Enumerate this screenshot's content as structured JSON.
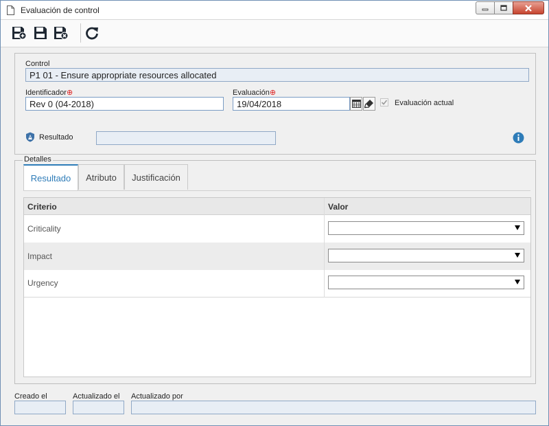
{
  "window": {
    "title": "Evaluación de control"
  },
  "toolbar": {
    "buttons": [
      {
        "icon": "save-and-new-icon"
      },
      {
        "icon": "save-icon"
      },
      {
        "icon": "save-and-close-icon"
      },
      {
        "icon": "refresh-icon"
      }
    ]
  },
  "form": {
    "control_label": "Control",
    "control_value": "P1 01 - Ensure appropriate resources allocated",
    "identifier_label": "Identificador",
    "identifier_value": "Rev 0 (04-2018)",
    "evaluation_label": "Evaluación",
    "evaluation_value": "19/04/2018",
    "current_eval_label": "Evaluación actual",
    "current_eval_checked": true,
    "result_label": "Resultado",
    "result_value": ""
  },
  "details": {
    "legend": "Detalles",
    "tabs": [
      {
        "label": "Resultado",
        "active": true
      },
      {
        "label": "Atributo",
        "active": false
      },
      {
        "label": "Justificación",
        "active": false
      }
    ],
    "columns": [
      "Criterio",
      "Valor"
    ],
    "rows": [
      {
        "criterion": "Criticality",
        "value": ""
      },
      {
        "criterion": "Impact",
        "value": ""
      },
      {
        "criterion": "Urgency",
        "value": ""
      }
    ]
  },
  "footer": {
    "created_label": "Creado el",
    "updated_label": "Actualizado el",
    "updated_by_label": "Actualizado por",
    "created_value": "",
    "updated_value": "",
    "updated_by_value": ""
  },
  "colors": {
    "accent": "#2e7cb8",
    "required": "#dd2222",
    "info": "#2e7cb8"
  }
}
